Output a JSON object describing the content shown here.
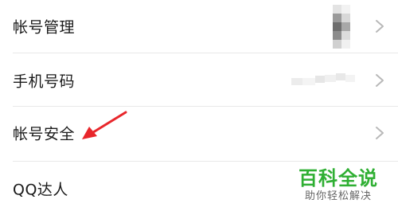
{
  "settings": {
    "items": [
      {
        "label": "帐号管理"
      },
      {
        "label": "手机号码"
      },
      {
        "label": "帐号安全"
      },
      {
        "label": "QQ达人"
      }
    ]
  },
  "watermark": {
    "title": "百科全说",
    "subtitle": "助你轻松解决"
  },
  "colors": {
    "arrow": "#e8262b",
    "watermark_title": "#2faf33",
    "chevron": "#b8b8b8",
    "divider": "#e8e8e8"
  },
  "icons": {
    "row_arrow": "chevron-right-icon",
    "annotation": "red-arrow-icon"
  }
}
